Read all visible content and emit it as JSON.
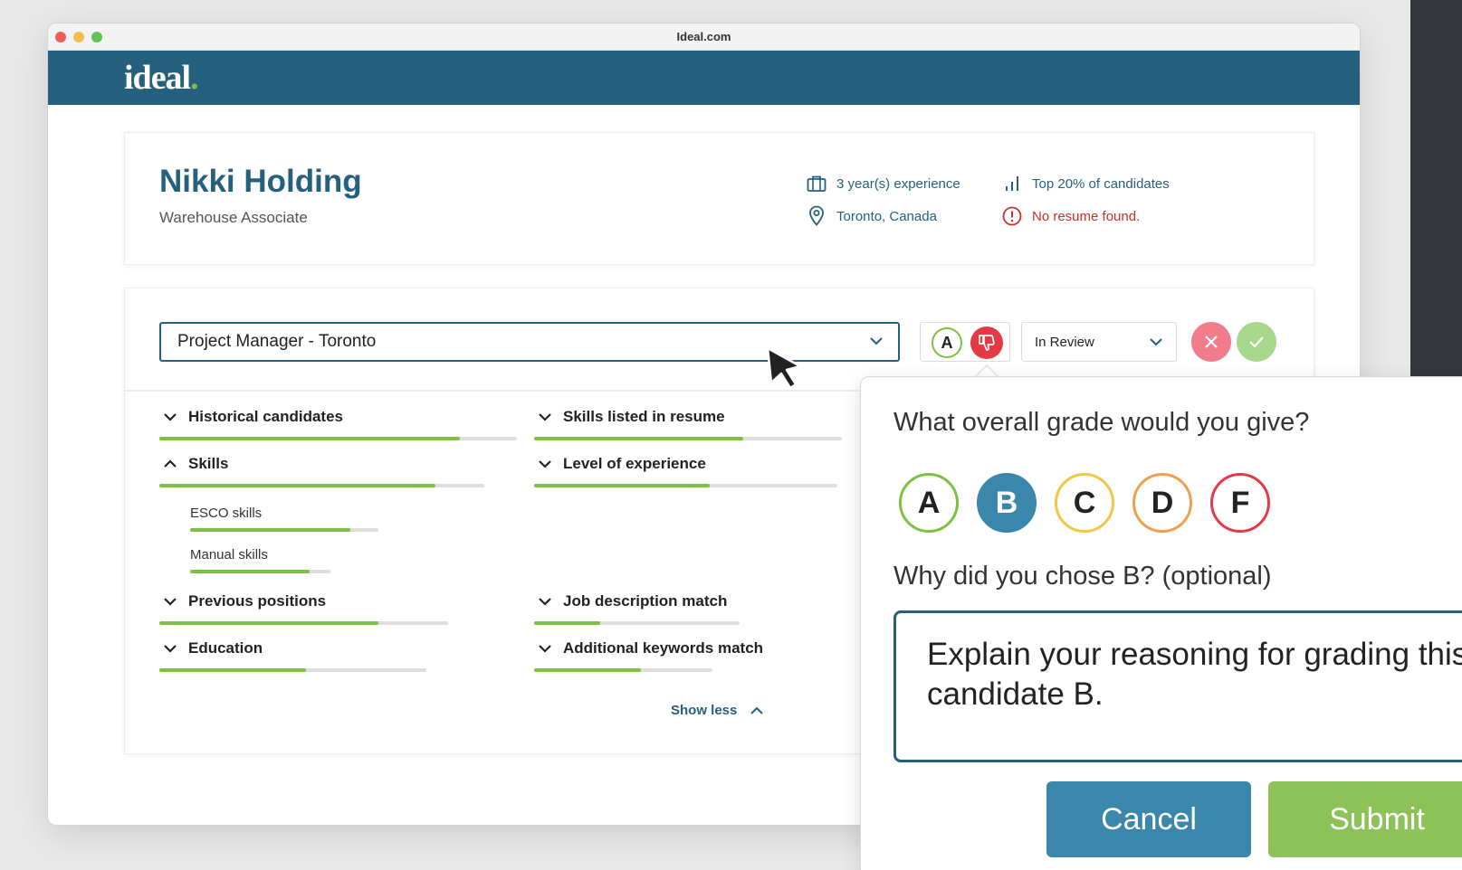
{
  "browser": {
    "url": "Ideal.com"
  },
  "app": {
    "logo": "ideal",
    "logo_dot": ".",
    "brand_color": "#25617e",
    "accent_color": "#7dc142"
  },
  "candidate": {
    "name": "Nikki Holding",
    "role": "Warehouse Associate",
    "experience": "3 year(s) experience",
    "location": "Toronto, Canada",
    "rank": "Top 20% of candidates",
    "resume_status": "No resume found."
  },
  "job": {
    "selected": "Project Manager - Toronto"
  },
  "grading": {
    "current_grade": "A",
    "status": "In Review"
  },
  "criteria": [
    {
      "label": "Historical candidates",
      "expanded": false,
      "score": 0.84
    },
    {
      "label": "Skills",
      "expanded": true,
      "score": 0.85,
      "children": [
        {
          "label": "ESCO skills",
          "score": 0.85
        },
        {
          "label": "Manual skills",
          "score": 0.85
        }
      ]
    },
    {
      "label": "Previous positions",
      "expanded": false,
      "score": 0.76
    },
    {
      "label": "Education",
      "expanded": false,
      "score": 0.55
    },
    {
      "label": "Skills listed in resume",
      "expanded": false,
      "score": 0.68
    },
    {
      "label": "Level of experience",
      "expanded": false,
      "score": 0.58
    },
    {
      "label": "Job description match",
      "expanded": false,
      "score": 0.32
    },
    {
      "label": "Additional keywords match",
      "expanded": false,
      "score": 0.6
    }
  ],
  "show_less": "Show less",
  "popover": {
    "question": "What overall grade would you give?",
    "grades": [
      {
        "letter": "A",
        "color": "#7dc142"
      },
      {
        "letter": "B",
        "color": "#3a87ab",
        "selected": true
      },
      {
        "letter": "C",
        "color": "#f2c744"
      },
      {
        "letter": "D",
        "color": "#f0a04b"
      },
      {
        "letter": "F",
        "color": "#e63946"
      }
    ],
    "reason_question": "Why did you chose B? (optional)",
    "reason_placeholder": "Explain your reasoning for grading this candidate B.",
    "cancel_label": "Cancel",
    "submit_label": "Submit"
  }
}
